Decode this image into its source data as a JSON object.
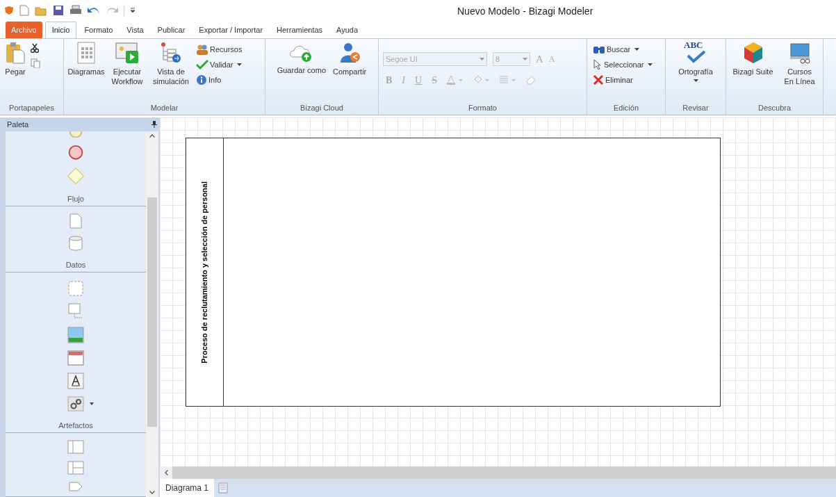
{
  "window": {
    "title": "Nuevo Modelo - Bizagi Modeler"
  },
  "ribbon": {
    "tabs": [
      {
        "label": "Archivo",
        "kind": "file"
      },
      {
        "label": "Inicio",
        "kind": "tab",
        "selected": true
      },
      {
        "label": "Formato",
        "kind": "tab",
        "selected": false
      },
      {
        "label": "Vista",
        "kind": "tab",
        "selected": false
      },
      {
        "label": "Publicar",
        "kind": "tab",
        "selected": false
      },
      {
        "label": "Exportar / Importar",
        "kind": "tab",
        "selected": false
      },
      {
        "label": "Herramientas",
        "kind": "tab",
        "selected": false
      },
      {
        "label": "Ayuda",
        "kind": "tab",
        "selected": false
      }
    ],
    "groups": [
      {
        "label": "Portapapeles",
        "items": [
          {
            "label": "Pegar"
          }
        ]
      },
      {
        "label": "Modelar",
        "items": [
          {
            "label": "Diagramas"
          },
          {
            "label": "Ejecutar Workflow"
          },
          {
            "label": "Vista de simulación"
          },
          {
            "label": "Recursos"
          },
          {
            "label": "Validar"
          },
          {
            "label": "Info"
          }
        ]
      },
      {
        "label": "Bizagi Cloud",
        "items": [
          {
            "label": "Guardar como"
          },
          {
            "label": "Compartir"
          }
        ]
      },
      {
        "label": "Formato",
        "font": "Segoe UI",
        "size": "8",
        "disabled": true,
        "buttons": [
          "B",
          "I",
          "U",
          "S"
        ],
        "grow": "A",
        "shrink": "A"
      },
      {
        "label": "Edición",
        "items": [
          {
            "label": "Buscar"
          },
          {
            "label": "Seleccionar"
          },
          {
            "label": "Eliminar"
          }
        ]
      },
      {
        "label": "Revisar",
        "items": [
          {
            "label": "Ortografía",
            "icon_text": "ABC"
          }
        ]
      },
      {
        "label": "Descubra",
        "items": [
          {
            "label": "Bizagi Suite"
          },
          {
            "label": "Cursos En Línea"
          }
        ]
      }
    ]
  },
  "palette": {
    "title": "Paleta",
    "sections": [
      {
        "label": "Flujo"
      },
      {
        "label": "Datos"
      },
      {
        "label": "Artefactos"
      }
    ]
  },
  "diagram": {
    "pool_label": "Proceso de reclutamiento y selección de personal"
  },
  "diagram_tabs": [
    {
      "label": "Diagrama 1",
      "selected": true
    }
  ]
}
